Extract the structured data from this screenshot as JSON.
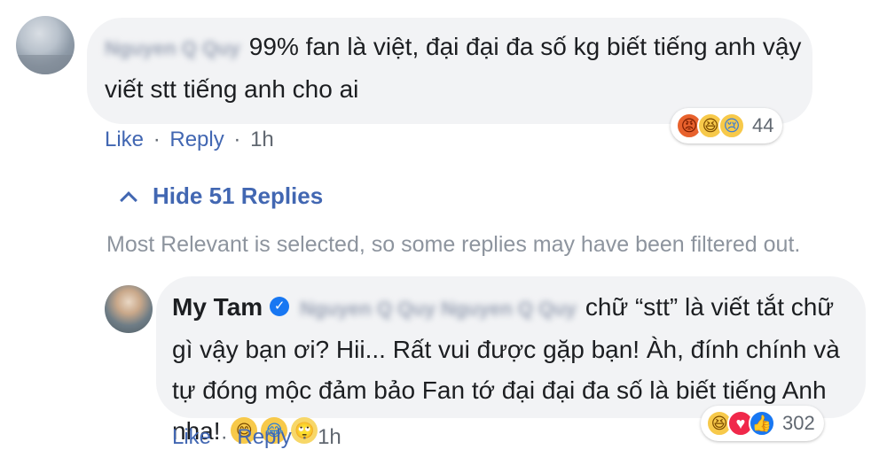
{
  "top_comment": {
    "author": "Nguyen Q Quy",
    "text": "99% fan là việt, đại đại đa số kg biết tiếng anh vậy viết stt tiếng anh cho ai",
    "like_label": "Like",
    "reply_label": "Reply",
    "time": "1h",
    "reaction_icons": [
      "angry-reaction-icon",
      "haha-reaction-icon",
      "sad-reaction-icon"
    ],
    "reaction_count": "44"
  },
  "replies_toggle": {
    "label": "Hide 51 Replies",
    "filter_note": "Most Relevant is selected, so some replies may have been filtered out."
  },
  "reply": {
    "author": "My Tam",
    "verified": true,
    "mention": "Nguyen Q Quy Nguyen Q Quy",
    "text": "chữ “stt” là viết tắt chữ gì vậy bạn ơi? Hii... Rất vui được gặp bạn! Àh, đính chính và tự đóng mộc đảm bảo Fan tớ đại đại đa số là biết tiếng Anh nha!",
    "inline_emojis": [
      "smiling-face-icon",
      "tears-of-joy-icon",
      "dizzy-face-icon"
    ],
    "like_label": "Like",
    "reply_label": "Reply",
    "time": "1h",
    "reaction_icons": [
      "haha-reaction-icon",
      "love-reaction-icon",
      "like-reaction-icon"
    ],
    "reaction_count": "302"
  },
  "colors": {
    "link": "#4267b2",
    "bubble": "#f2f3f5",
    "muted": "#8d949e",
    "text": "#1c1e21"
  }
}
